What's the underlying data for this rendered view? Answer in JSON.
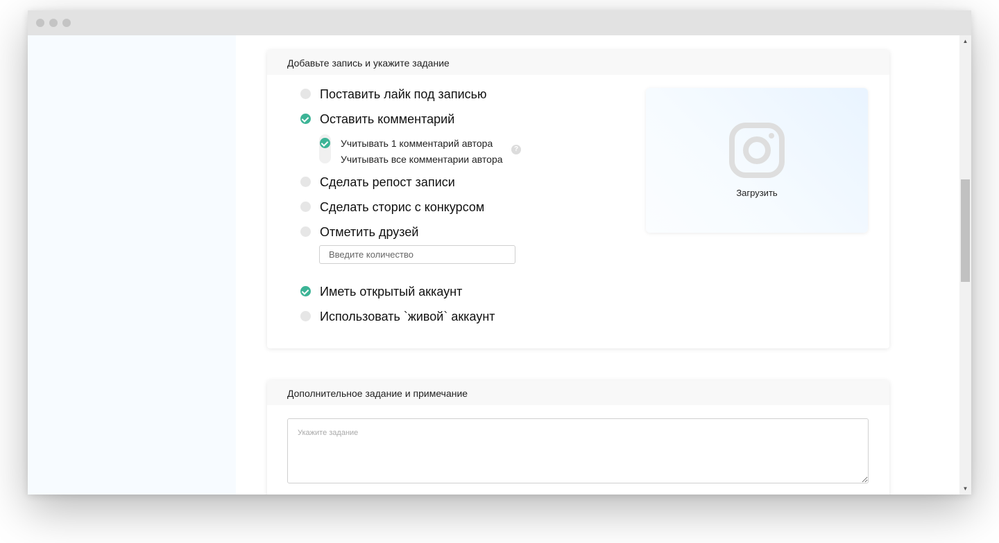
{
  "section1": {
    "title": "Добавьте запись и укажите задание",
    "options": [
      {
        "label": "Поставить лайк под записью",
        "checked": false
      },
      {
        "label": "Оставить комментарий",
        "checked": true
      },
      {
        "label": "Сделать репост записи",
        "checked": false
      },
      {
        "label": "Сделать сторис с конкурсом",
        "checked": false
      },
      {
        "label": "Отметить друзей",
        "checked": false
      },
      {
        "label": "Иметь открытый аккаунт",
        "checked": true
      },
      {
        "label": "Использовать `живой` аккаунт",
        "checked": false
      }
    ],
    "comment_sub": {
      "option1": "Учитывать 1 комментарий автора",
      "option2": "Учитывать все комментарии автора",
      "selected": "option1",
      "help_symbol": "?"
    },
    "friends_count": {
      "placeholder": "Введите количество",
      "value": ""
    },
    "upload": {
      "label": "Загрузить",
      "icon": "instagram-icon"
    }
  },
  "section2": {
    "title": "Дополнительное задание и примечание",
    "task": {
      "placeholder": "Укажите задание",
      "value": ""
    }
  },
  "colors": {
    "accent": "#3cb496",
    "sidebar_bg": "#f7fbff",
    "card_header_bg": "#f8f8f8"
  },
  "scrollbar": {
    "up_arrow": "▲",
    "down_arrow": "▼"
  }
}
